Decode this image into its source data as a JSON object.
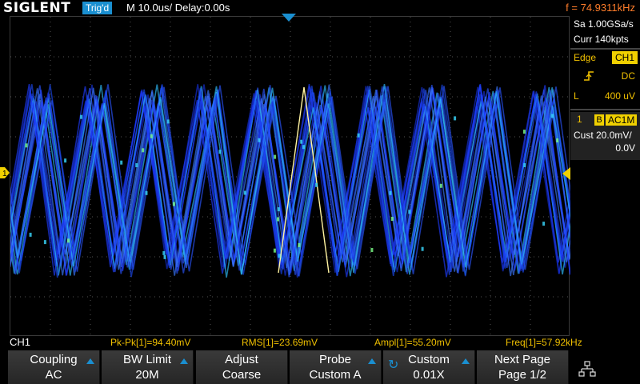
{
  "header": {
    "brand": "SIGLENT",
    "trigger_status": "Trig'd",
    "timebase": "M 10.0us/  Delay:0.00s",
    "frequency": "f = 74.9311kHz"
  },
  "acquisition": {
    "sample_rate": "Sa 1.00GSa/s",
    "memory_depth": "Curr 140kpts"
  },
  "trigger": {
    "type": "Edge",
    "source": "CH1",
    "coupling": "DC",
    "level_label": "L",
    "level_value": "400 uV"
  },
  "channel": {
    "number": "1",
    "bandwidth_flag": "B",
    "coupling_badge": "AC1M",
    "scale": "Cust 20.0mV/",
    "offset": "0.0V",
    "marker": "1"
  },
  "measurements": {
    "channel_label": "CH1",
    "items": [
      "Pk-Pk[1]=94.40mV",
      "RMS[1]=23.69mV",
      "Ampl[1]=55.20mV",
      "Freq[1]=57.92kHz"
    ]
  },
  "softkeys": [
    {
      "line1": "Coupling",
      "line2": "AC"
    },
    {
      "line1": "BW Limit",
      "line2": "20M"
    },
    {
      "line1": "Adjust",
      "line2": "Coarse"
    },
    {
      "line1": "Probe",
      "line2": "Custom A"
    },
    {
      "line1": "Custom",
      "line2": "0.01X"
    },
    {
      "line1": "Next Page",
      "line2": "Page 1/2"
    }
  ],
  "colors": {
    "accent_blue": "#1a8fd0",
    "channel_yellow": "#f0d000",
    "frequency_orange": "#ff7d2a",
    "trace_blue": "#1f3cff"
  },
  "icons": {
    "trigger_position": "triangle-down-icon",
    "trigger_level": "triangle-left-icon",
    "slope": "rising-edge-icon",
    "menu": "network-tree-icon"
  }
}
